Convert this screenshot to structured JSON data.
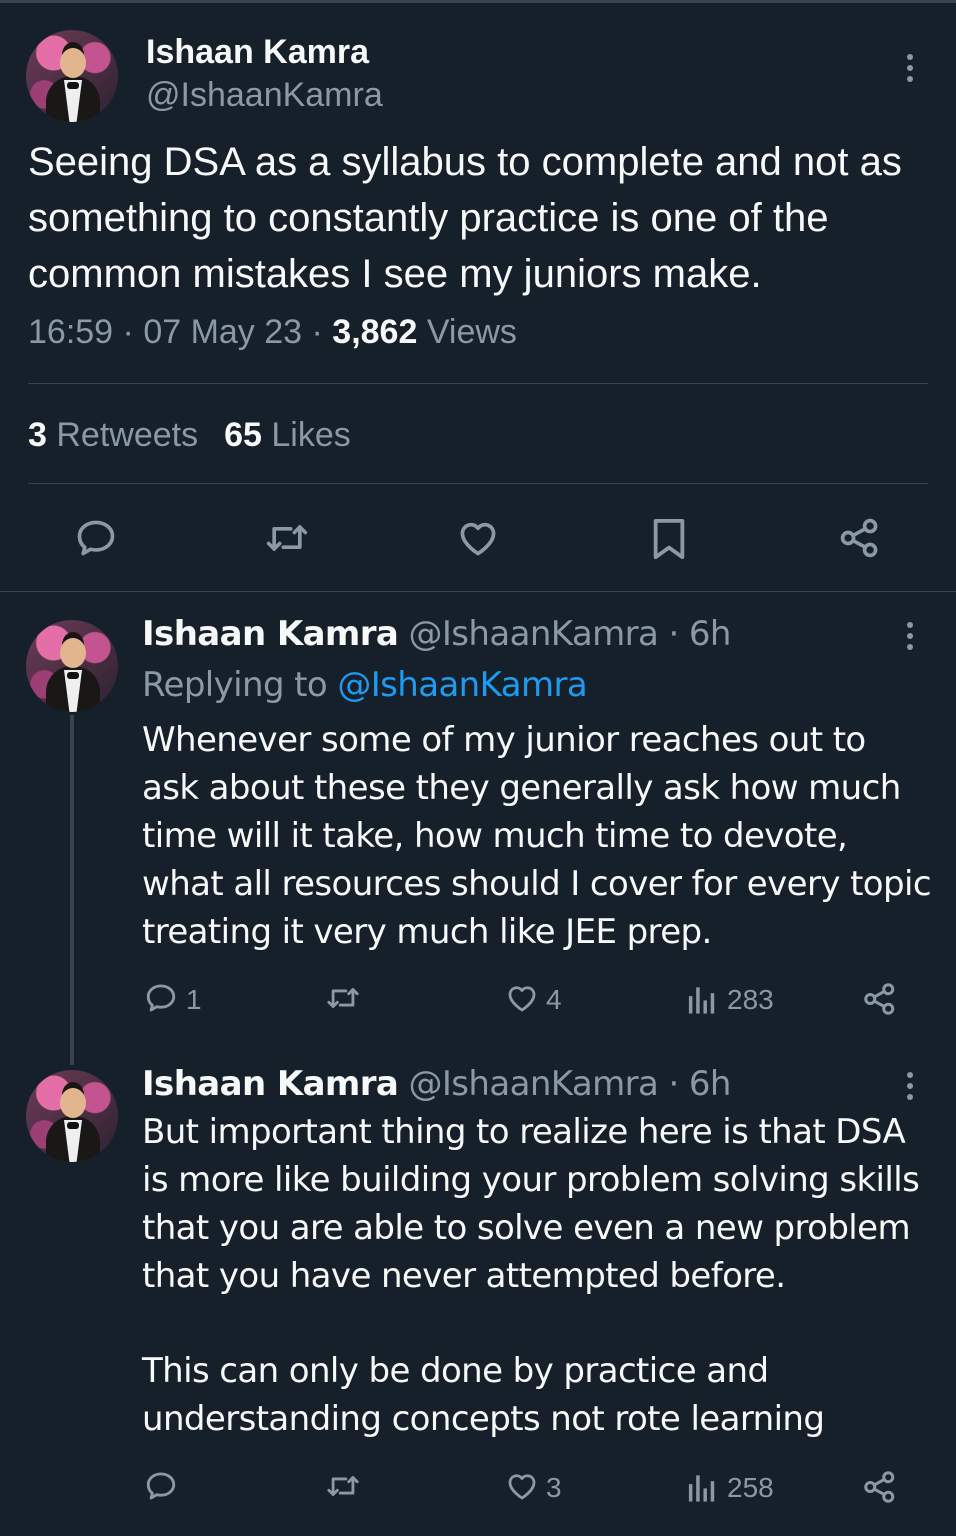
{
  "tweet": {
    "author_name": "Ishaan Kamra",
    "author_handle": "@IshaanKamra",
    "text": "Seeing DSA as a syllabus to complete and not as something to constantly practice is one of the common mistakes I see my juniors make.",
    "time": "16:59",
    "date": "07 May 23",
    "views_count": "3,862",
    "views_label": "Views",
    "retweets_count": "3",
    "retweets_label": "Retweets",
    "likes_count": "65",
    "likes_label": "Likes",
    "actions": [
      "reply-icon",
      "retweet-icon",
      "like-icon",
      "bookmark-icon",
      "share-icon"
    ]
  },
  "replies": [
    {
      "author_name": "Ishaan Kamra",
      "author_handle": "@IshaanKamra",
      "age": "6h",
      "replying_to_label": "Replying to",
      "replying_to_handle": "@IshaanKamra",
      "text": "Whenever some of my junior reaches out to ask about these they generally ask how much time will it take, how much time to devote, what all resources should I cover for every topic treating it very much like JEE prep.",
      "reply_count": "1",
      "retweet_count": "",
      "like_count": "4",
      "view_count": "283"
    },
    {
      "author_name": "Ishaan Kamra",
      "author_handle": "@IshaanKamra",
      "age": "6h",
      "text_p1": "But important thing to realize here is that DSA is more like building your problem solving skills that you are able to solve even a new problem that you have never attempted before.",
      "text_p2": "This can only be done by practice and understanding concepts not rote learning",
      "reply_count": "",
      "retweet_count": "",
      "like_count": "3",
      "view_count": "258"
    }
  ],
  "colors": {
    "background": "#15202b",
    "text": "#f7f9f9",
    "muted": "#8b98a5",
    "link": "#1d9bf0",
    "divider": "#38444d"
  }
}
